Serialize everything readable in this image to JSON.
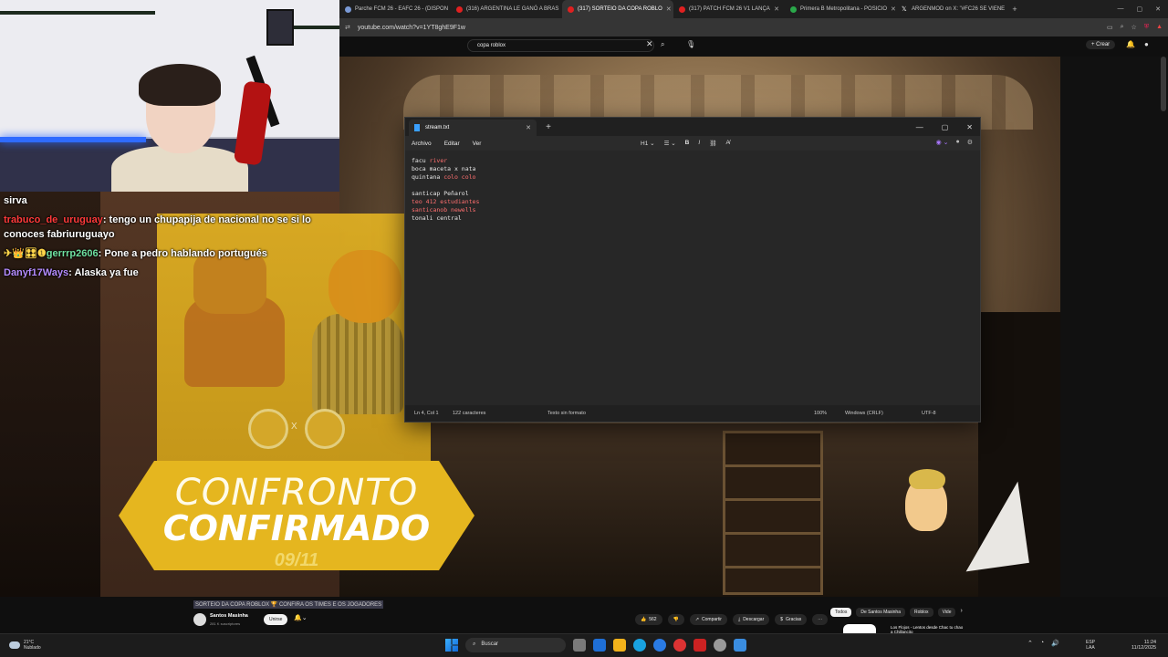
{
  "browser": {
    "tabs": [
      {
        "label": "Parche FCM 26 - EAFC 26 - (DISPON",
        "icon": "globe-icon"
      },
      {
        "label": "(316) ARGENTINA LE GANÓ A BRAS",
        "icon": "youtube-icon"
      },
      {
        "label": "(317) SORTEIO DA COPA ROBLO",
        "icon": "youtube-icon",
        "active": true
      },
      {
        "label": "(317) PATCH FCM 26 V1 LANÇA",
        "icon": "youtube-icon"
      },
      {
        "label": "Primera B Metropolitana - POSICIO",
        "icon": "green-icon"
      },
      {
        "label": "ARGENMOD on X: \"#FC26 SE VIENE",
        "icon": "x-icon"
      }
    ],
    "new_tab": "+",
    "url": "youtube.com/watch?v=1YT8ghE9F1w"
  },
  "youtube": {
    "search_value": "copa roblox",
    "create_label": "Crear",
    "video_title": "SORTEIO DA COPA ROBLOX 🏆 CONFIRA OS TIMES E OS JOGADORES",
    "channel_name": "Santos Masinha",
    "channel_subs": "281 K suscriptores",
    "join_label": "Unirse",
    "likes": "562",
    "share_label": "Compartir",
    "download_label": "Descargar",
    "thanks_label": "Gracias",
    "chips": [
      "Todos",
      "De Santos Masinha",
      "Roblox",
      "Vide"
    ],
    "rec_title": "Los Flojos - Lentos desde Chac tu chao a Chillancito"
  },
  "chat": [
    {
      "user": "",
      "text": "sirva",
      "color": "white"
    },
    {
      "user": "trabuco_de_uruguay",
      "text": "tengo un chupapija de nacional no se si lo conoces fabriuruguayo",
      "color": "red"
    },
    {
      "user": "gerrrp2606",
      "badges": "✈👑🎛❶",
      "text": "Pone a pedro hablando portugués",
      "color": "green"
    },
    {
      "user": "Danyf17Ways",
      "text": "Alaska ya fue",
      "color": "purple"
    }
  ],
  "overlay": {
    "line1": "CONFRONTO",
    "line2": "CONFIRMADO",
    "date": "09/11",
    "vs": "X"
  },
  "notepad": {
    "tab_title": "stream.txt",
    "menu": [
      "Archivo",
      "Editar",
      "Ver"
    ],
    "heading_btn": "H1",
    "lines": [
      {
        "a": "facu ",
        "b": "river"
      },
      {
        "a": "boca maceta x nata",
        "b": ""
      },
      {
        "a": "quintana ",
        "b": "colo colo"
      },
      {
        "a": "",
        "b": ""
      },
      {
        "a": "santicap Peñarol",
        "b": ""
      },
      {
        "a": "teo 412 estudiantes",
        "b": ""
      },
      {
        "a": "santicanob ",
        "b": "newells"
      },
      {
        "a": "tonali central",
        "b": ""
      }
    ],
    "status": {
      "position": "Ln 4, Col 1",
      "chars": "122 caracteres",
      "format": "Texto sin formato",
      "zoom": "100%",
      "eol": "Windows (CRLF)",
      "encoding": "UTF-8"
    }
  },
  "taskbar": {
    "temp": "21°C",
    "weather": "Nublado",
    "search_placeholder": "Buscar",
    "lang1": "ESP",
    "lang2": "LAA",
    "time": "11:24",
    "date": "11/12/2025"
  }
}
